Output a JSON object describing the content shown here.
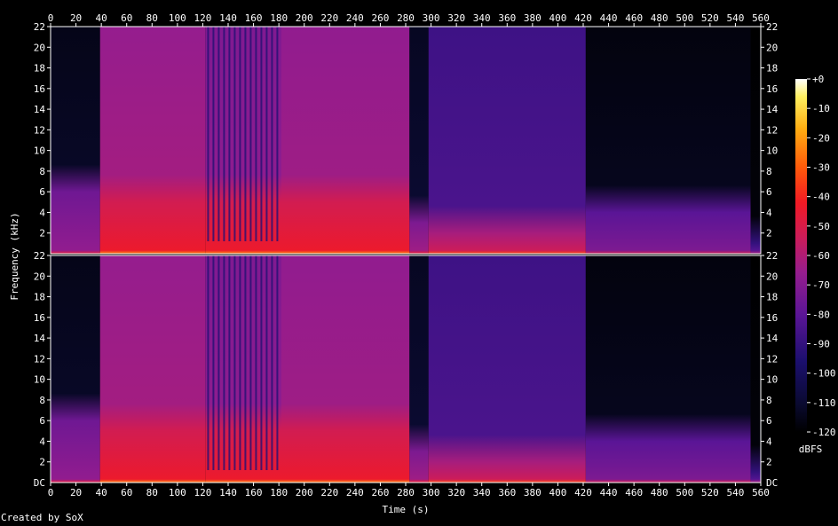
{
  "chart_data": {
    "type": "heatmap",
    "title": "",
    "xlabel": "Time (s)",
    "ylabel": "Frequency (kHz)",
    "xlim": [
      0,
      560
    ],
    "ylim": [
      0,
      22
    ],
    "x_ticks": [
      0,
      20,
      40,
      60,
      80,
      100,
      120,
      140,
      160,
      180,
      200,
      220,
      240,
      260,
      280,
      300,
      320,
      340,
      360,
      380,
      400,
      420,
      440,
      460,
      480,
      500,
      520,
      540,
      560
    ],
    "y_ticks": [
      {
        "value": 22,
        "label": "22"
      },
      {
        "value": 20,
        "label": "20"
      },
      {
        "value": 18,
        "label": "18"
      },
      {
        "value": 16,
        "label": "16"
      },
      {
        "value": 14,
        "label": "14"
      },
      {
        "value": 12,
        "label": "12"
      },
      {
        "value": 10,
        "label": "10"
      },
      {
        "value": 8,
        "label": "8"
      },
      {
        "value": 6,
        "label": "6"
      },
      {
        "value": 4,
        "label": "4"
      },
      {
        "value": 2,
        "label": "2"
      }
    ],
    "y_ticks_bottom_channel_dc_label": "DC",
    "channels": 2,
    "colorbar": {
      "label": "dBFS",
      "range": [
        -120,
        0
      ],
      "ticks": [
        {
          "value": 0,
          "label": "+0"
        },
        {
          "value": -10,
          "label": "-10"
        },
        {
          "value": -20,
          "label": "-20"
        },
        {
          "value": -30,
          "label": "-30"
        },
        {
          "value": -40,
          "label": "-40"
        },
        {
          "value": -50,
          "label": "-50"
        },
        {
          "value": -60,
          "label": "-60"
        },
        {
          "value": -70,
          "label": "-70"
        },
        {
          "value": -80,
          "label": "-80"
        },
        {
          "value": -90,
          "label": "-90"
        },
        {
          "value": -100,
          "label": "-100"
        },
        {
          "value": -110,
          "label": "-110"
        },
        {
          "value": -120,
          "label": "-120"
        }
      ]
    },
    "segments": [
      {
        "start": 0,
        "end": 39,
        "level": "quiet",
        "body_db": -112,
        "low_band_top_khz": 6,
        "low_db": -75
      },
      {
        "start": 39,
        "end": 122,
        "level": "loud",
        "body_db": -63,
        "low_band_top_khz": 5,
        "low_db": -52
      },
      {
        "start": 122,
        "end": 182,
        "level": "loud-striped",
        "body_db": -68,
        "low_band_top_khz": 5,
        "low_db": -52
      },
      {
        "start": 182,
        "end": 283,
        "level": "loud",
        "body_db": -64,
        "low_band_top_khz": 5,
        "low_db": -52
      },
      {
        "start": 283,
        "end": 298,
        "level": "quiet",
        "body_db": -110,
        "low_band_top_khz": 3,
        "low_db": -72
      },
      {
        "start": 298,
        "end": 422,
        "level": "medium",
        "body_db": -84,
        "low_band_top_khz": 2,
        "low_db": -62
      },
      {
        "start": 422,
        "end": 552,
        "level": "quiet",
        "body_db": -114,
        "low_band_top_khz": 4,
        "low_db": -80
      },
      {
        "start": 552,
        "end": 560,
        "level": "quiet",
        "body_db": -118,
        "low_band_top_khz": 1,
        "low_db": -90
      }
    ]
  },
  "footer": {
    "credit": "Created by SoX"
  }
}
